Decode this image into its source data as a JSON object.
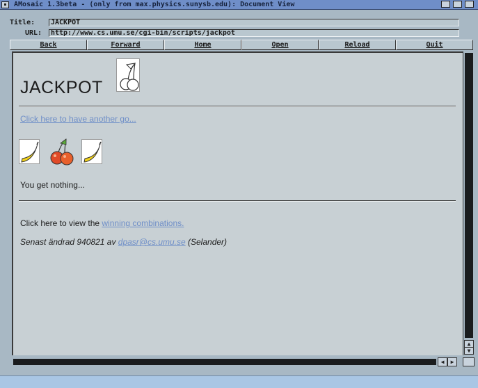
{
  "window": {
    "title": "AMosaic 1.3beta - (only from max.physics.sunysb.edu): Document View"
  },
  "toolbar": {
    "title_label": "Title:",
    "title_value": "JACKPOT",
    "url_label": "URL:",
    "url_value": "http://www.cs.umu.se/cgi-bin/scripts/jackpot"
  },
  "nav": {
    "back": "Back",
    "forward": "Forward",
    "home": "Home",
    "open": "Open",
    "reload": "Reload",
    "quit": "Quit"
  },
  "page": {
    "heading": "JACKPOT",
    "again_link": "Click here to have another go...",
    "reels": [
      "banana",
      "cherries",
      "banana"
    ],
    "result": "You get nothing...",
    "view_prefix": "Click here to view the ",
    "view_link": "winning combinations.",
    "sig_prefix": "Senast ändrad 940821 av ",
    "sig_email": "dpasr@cs.umu.se",
    "sig_suffix": " (Selander)"
  },
  "colors": {
    "link": "#6e8ec8",
    "content_bg": "#c8d0d4",
    "chrome_bg": "#a8b8c4",
    "titlebar": "#6f8ec8"
  }
}
